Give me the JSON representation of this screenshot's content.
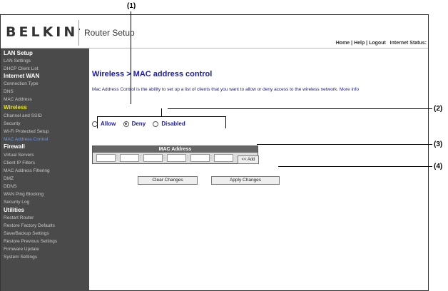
{
  "header": {
    "logo": "BELKIN",
    "app_title": "Router Setup",
    "links": [
      "Home",
      "Help",
      "Logout"
    ],
    "status_label": "Internet Status:"
  },
  "sidebar": {
    "sections": [
      {
        "title": "LAN Setup",
        "items": [
          "LAN Settings",
          "DHCP Client List"
        ]
      },
      {
        "title": "Internet WAN",
        "items": [
          "Connection Type",
          "DNS",
          "MAC Address"
        ]
      },
      {
        "title": "Wireless",
        "items": [
          "Channel and SSID",
          "Security",
          "Wi-Fi Protected Setup",
          "MAC Address Control"
        ]
      },
      {
        "title": "Firewall",
        "items": [
          "Virtual Servers",
          "Client IP Filters",
          "MAC Address Filtering",
          "DMZ",
          "DDNS",
          "WAN Ping Blocking",
          "Security Log"
        ]
      },
      {
        "title": "Utilities",
        "items": [
          "Restart Router",
          "Restore Factory Defaults",
          "Save/Backup Settings",
          "Restore Previous Settings",
          "Firmware Update",
          "System Settings"
        ]
      }
    ]
  },
  "main": {
    "title": "Wireless > MAC address control",
    "description": "Mac Address Control is the ability to set up a list of clients that you want to allow or deny access to the wireless network.",
    "more_info": "More info",
    "mode_options": [
      "Allow",
      "Deny",
      "Disabled"
    ],
    "mode_selected": "Deny",
    "mac_table_header": "MAC Address",
    "add_button": "<< Add",
    "clear_button": "Clear Changes",
    "apply_button": "Apply Changes"
  },
  "callouts": [
    "(1)",
    "(2)",
    "(3)",
    "(4)"
  ]
}
